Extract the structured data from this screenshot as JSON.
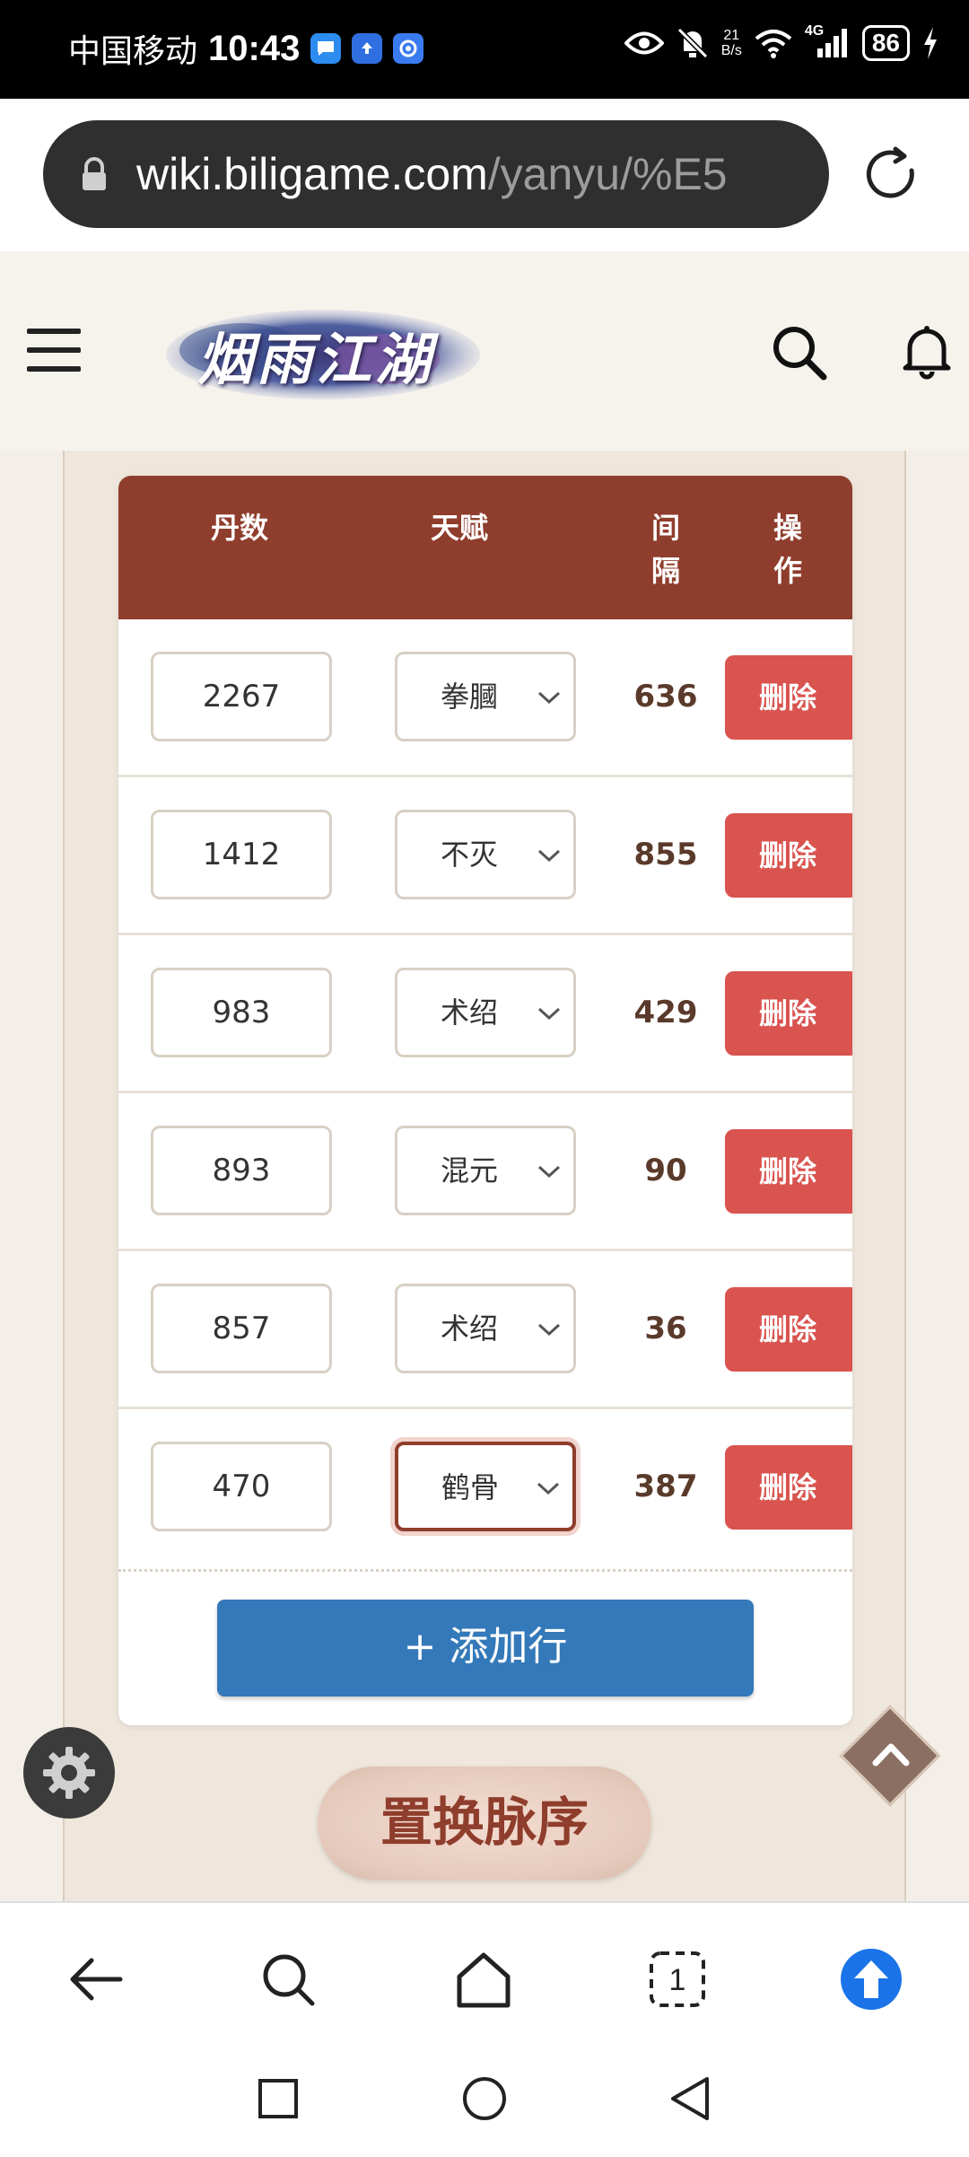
{
  "status_bar": {
    "carrier": "中国移动",
    "time": "10:43",
    "net_speed_value": "21",
    "net_speed_unit": "B/s",
    "network_type": "4G",
    "battery": "86"
  },
  "browser": {
    "url_domain": "wiki.biligame.com",
    "url_path": "/yanyu/%E5"
  },
  "site": {
    "logo_text": "烟雨江湖"
  },
  "table": {
    "headers": {
      "dan": "丹数",
      "tian": "天赋",
      "jian_1": "间",
      "jian_2": "隔",
      "op_1": "操",
      "op_2": "作"
    },
    "rows": [
      {
        "dan": "2267",
        "tian": "拳膕",
        "jian": "636",
        "op": "删除"
      },
      {
        "dan": "1412",
        "tian": "不灭",
        "jian": "855",
        "op": "删除"
      },
      {
        "dan": "983",
        "tian": "术绍",
        "jian": "429",
        "op": "删除"
      },
      {
        "dan": "893",
        "tian": "混元",
        "jian": "90",
        "op": "删除"
      },
      {
        "dan": "857",
        "tian": "术绍",
        "jian": "36",
        "op": "删除"
      },
      {
        "dan": "470",
        "tian": "鹤骨",
        "jian": "387",
        "op": "删除"
      }
    ],
    "add_row_label": "+ 添加行"
  },
  "actions": {
    "swap_label": "置换脉序"
  },
  "colors": {
    "header_bg": "#8f3d2c",
    "delete_bg": "#d9534f",
    "add_bg": "#3479b9",
    "upload_blue": "#1a73e8"
  }
}
